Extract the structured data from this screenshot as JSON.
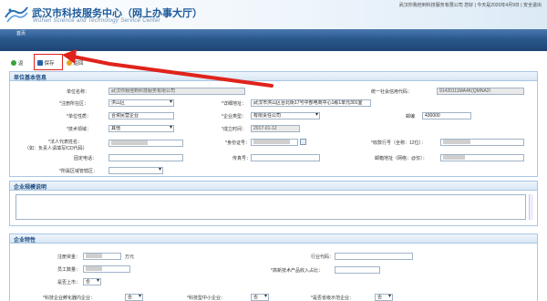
{
  "header": {
    "title_cn": "武汉市科技服务中心（网上办事大厅）",
    "title_en": "Wuhan Science and Technology  Service Center",
    "user_info": "武汉你我他到科技服务有限公司 您好 | 今天是2020年4月9日 | 安全退出"
  },
  "nav": {
    "home": "首页"
  },
  "toolbar": {
    "back_short": "返",
    "save": "保存",
    "return": "返回"
  },
  "section1": {
    "title": "单位基本信息",
    "fields": {
      "unit_name_label": "单位名称：",
      "unit_name_value": "武汉你我他到科技服务有限公司",
      "credit_code_label": "统一社会信用代码：",
      "credit_code_value": "91420111MA4K(QMNA2I",
      "district_label": "*注册所在区：",
      "district_value": "洪山区",
      "address_label": "*详细地址：",
      "address_value": "武汉市洪山区台北街17号中部电商中心1栋1单元301室",
      "nature_label": "*单位性质：",
      "nature_value": "合资民营企业",
      "type_label": "*企业类型：",
      "type_value": "有限责任公司",
      "postcode_label": "邮编",
      "postcode_value": "430000",
      "industry_label": "*技术领域：",
      "industry_value": "其他",
      "founded_label": "*成立时间：",
      "founded_value": "2017-01-12",
      "contact_label": "*法人代表姓名：",
      "contact_hint": "（如：负责人请填写ICD代码）",
      "idno_label": "*身份证号：",
      "bank_label": "*收款行号（全称：12位）：",
      "phone_label": "固定电话：",
      "fax_label": "传真号：",
      "email_label": "邮箱地址（网络：@仅）：",
      "region_label": "*所属区域管辖区："
    }
  },
  "section2": {
    "title": "企业规模说明"
  },
  "section3": {
    "title": "企业特性",
    "fields": {
      "capital_label": "注册资金：",
      "capital_unit": "万元",
      "industry2_label": "行业代码：",
      "employees_label": "员工数量：",
      "hightech_label": "*高新技术产品收入占比：",
      "listed_label": "是否上市：",
      "listed_value": "否",
      "f1_label": "*科技企业孵化器内企业：",
      "f1_value": "否",
      "f2_label": "*科技型中小企业：",
      "f2_value": "否",
      "f3_label": "*是否省级示范企业：",
      "f3_value": "否"
    }
  }
}
